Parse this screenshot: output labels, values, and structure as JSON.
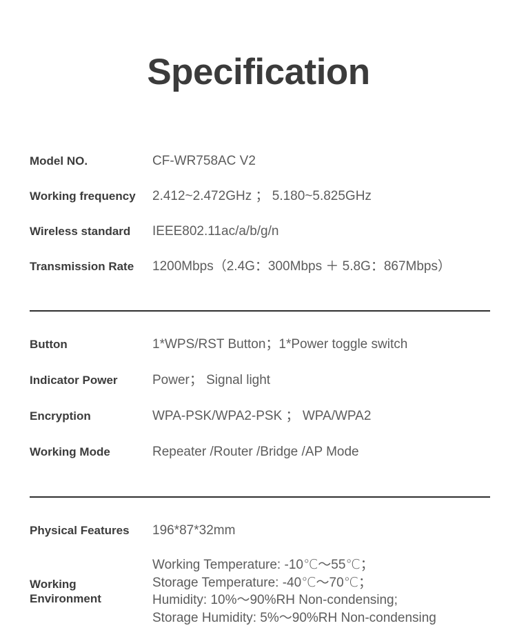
{
  "page": {
    "title": "Specification",
    "background_color": "#ffffff",
    "title_color": "#3b3b3b",
    "label_color": "#3c3c3c",
    "value_color": "#5c5c5c",
    "divider_color": "#2e2e2e"
  },
  "groups": [
    {
      "rows": [
        {
          "label": "Model NO.",
          "value": "CF-WR758AC V2"
        },
        {
          "label": "Working frequency",
          "value": "2.412~2.472GHz ； 5.180~5.825GHz"
        },
        {
          "label": "Wireless standard",
          "value": "IEEE802.11ac/a/b/g/n"
        },
        {
          "label": "Transmission Rate",
          "value": "1200Mbps（2.4G：300Mbps ＋ 5.8G：867Mbps）"
        }
      ]
    },
    {
      "rows": [
        {
          "label": "Button",
          "value": "1*WPS/RST Button；1*Power toggle switch"
        },
        {
          "label": "Indicator Power",
          "value": "Power； Signal light"
        },
        {
          "label": "Encryption",
          "value": "WPA-PSK/WPA2-PSK  ；  WPA/WPA2"
        },
        {
          "label": "Working Mode",
          "value": "Repeater /Router /Bridge /AP Mode"
        }
      ]
    },
    {
      "rows": [
        {
          "label": "Physical Features",
          "value": "196*87*32mm"
        },
        {
          "label": "Working\nEnvironment",
          "value": "Working Temperature: -10℃～55℃；\nStorage Temperature: -40℃～70℃；\nHumidity: 10%～90%RH Non-condensing;\nStorage Humidity: 5%～90%RH Non-condensing"
        }
      ]
    }
  ]
}
